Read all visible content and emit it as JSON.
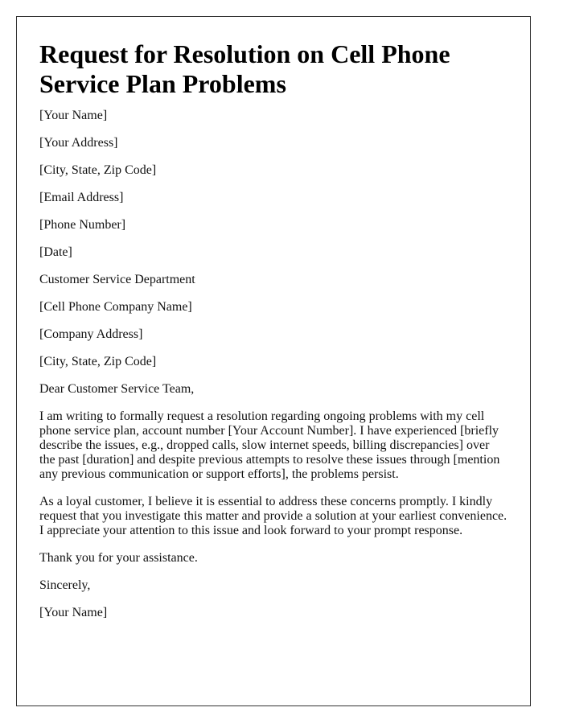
{
  "title": "Request for Resolution on Cell Phone Service Plan Problems",
  "sender": {
    "name": "[Your Name]",
    "address": "[Your Address]",
    "city_state_zip": "[City, State, Zip Code]",
    "email": "[Email Address]",
    "phone": "[Phone Number]",
    "date": "[Date]"
  },
  "recipient": {
    "department": "Customer Service Department",
    "company": "[Cell Phone Company Name]",
    "address": "[Company Address]",
    "city_state_zip": "[City, State, Zip Code]"
  },
  "salutation": "Dear Customer Service Team,",
  "body": [
    "I am writing to formally request a resolution regarding ongoing problems with my cell phone service plan, account number [Your Account Number]. I have experienced [briefly describe the issues, e.g., dropped calls, slow internet speeds, billing discrepancies] over the past [duration] and despite previous attempts to resolve these issues through [mention any previous communication or support efforts], the problems persist.",
    "As a loyal customer, I believe it is essential to address these concerns promptly. I kindly request that you investigate this matter and provide a solution at your earliest convenience. I appreciate your attention to this issue and look forward to your prompt response.",
    "Thank you for your assistance."
  ],
  "closing": "Sincerely,",
  "signature": "[Your Name]"
}
